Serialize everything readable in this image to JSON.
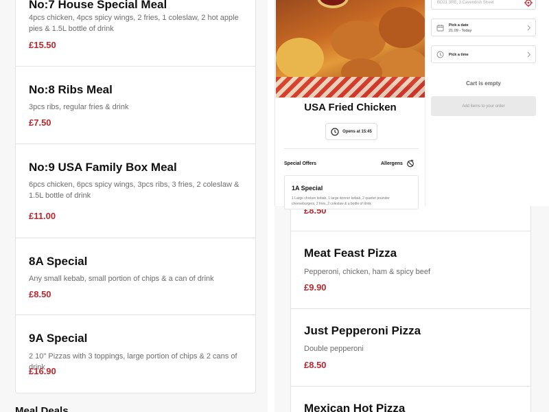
{
  "menu": {
    "items": [
      {
        "name": "No:7 House Special Meal",
        "description": "4pcs chicken, 4pcs spicy wings, 2 fries, 1 coleslaw, 2 hot apple pies & 1.5L bottle of drink",
        "price": "£15.50"
      },
      {
        "name": "No:8 Ribs Meal",
        "description": "3pcs ribs, regular fries & drink",
        "price": "£7.50"
      },
      {
        "name": "No:9 USA Family Box Meal",
        "description": "6pcs chicken, 6pcs spicy wings, 3pcs ribs, 3 fries, 2 coleslaw & 1.5L bottle of drink",
        "price": "£11.00"
      },
      {
        "name": "8A Special",
        "description": "Any small kebab, small portion of chips & a can of drink",
        "price": "£8.50"
      },
      {
        "name": "9A Special",
        "description": "2 10\" Pizzas with 3 toppings, large portion of chips & 2 cans of drink",
        "price": "£16.90"
      }
    ],
    "next_section": "Meal Deals",
    "pizzas": [
      {
        "name": "",
        "description": "",
        "price": "£8.50"
      },
      {
        "name": "Meat Feast Pizza",
        "description": "Pepperoni, chicken, ham & spicy beef",
        "price": "£9.90"
      },
      {
        "name": "Just Pepperoni Pizza",
        "description": "Double pepperoni",
        "price": "£8.50"
      },
      {
        "name": "Mexican Hot Pizza",
        "description": "",
        "price": ""
      }
    ]
  },
  "shop": {
    "name": "USA Fried Chicken",
    "opens": "Opens at 15:45",
    "special_offers_label": "Special Offers",
    "allergens_label": "Allergens",
    "offer": {
      "name": "1A Special",
      "description": "1 Large chicken kebab, 1 large donner kebab, 2 quarter pounder cheeseburgers, 2 fries, 2 coleslaw & a bottle of drink"
    }
  },
  "order": {
    "postcode": "BD21 3RE, 3 Cavendish Street",
    "date_label": "Pick a date",
    "date_value": "21.09 - Today",
    "time_label": "Pick a time",
    "cart_status": "Cart is empty",
    "add_items_label": "Add items to your order"
  },
  "colors": {
    "price": "#c0262d",
    "pin": "#c0262d"
  }
}
